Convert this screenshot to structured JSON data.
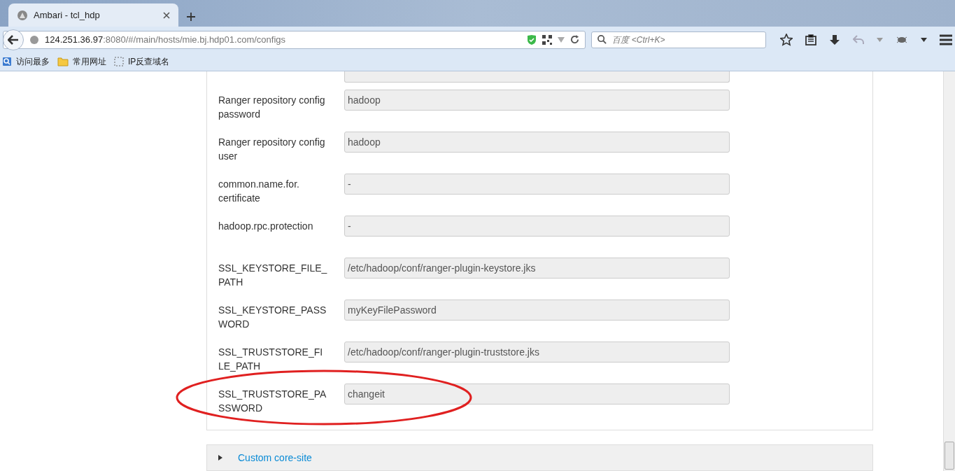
{
  "browser": {
    "tab": {
      "title": "Ambari - tcl_hdp"
    },
    "address": {
      "host": "124.251.36.97",
      "rest": ":8080/#/main/hosts/mie.bj.hdp01.com/configs"
    },
    "search": {
      "placeholder": "百度 <Ctrl+K>"
    },
    "bookmarks": [
      {
        "kind": "history",
        "label": "访问最多"
      },
      {
        "kind": "folder",
        "label": "常用网址"
      },
      {
        "kind": "page",
        "label": "IP反查域名"
      }
    ]
  },
  "config": {
    "rows": [
      {
        "label": "Ranger repository config password",
        "value": "hadoop",
        "highlighted": false
      },
      {
        "label": "Ranger repository config user",
        "value": "hadoop",
        "highlighted": false
      },
      {
        "label": "common.name.for. certificate",
        "value": "-",
        "highlighted": false
      },
      {
        "label": "hadoop.rpc.protection",
        "value": "-",
        "highlighted": false
      },
      {
        "label": "SSL_KEYSTORE_FILE_PATH",
        "value": "/etc/hadoop/conf/ranger-plugin-keystore.jks",
        "highlighted": false
      },
      {
        "label": "SSL_KEYSTORE_PASSWORD",
        "value": "myKeyFilePassword",
        "highlighted": false
      },
      {
        "label": "SSL_TRUSTSTORE_FILE_PATH",
        "value": "/etc/hadoop/conf/ranger-plugin-truststore.jks",
        "highlighted": false
      },
      {
        "label": "SSL_TRUSTSTORE_PASSWORD",
        "value": "changeit",
        "highlighted": true
      }
    ]
  },
  "sections": [
    {
      "title": "Custom core-site",
      "expanded": false
    }
  ]
}
